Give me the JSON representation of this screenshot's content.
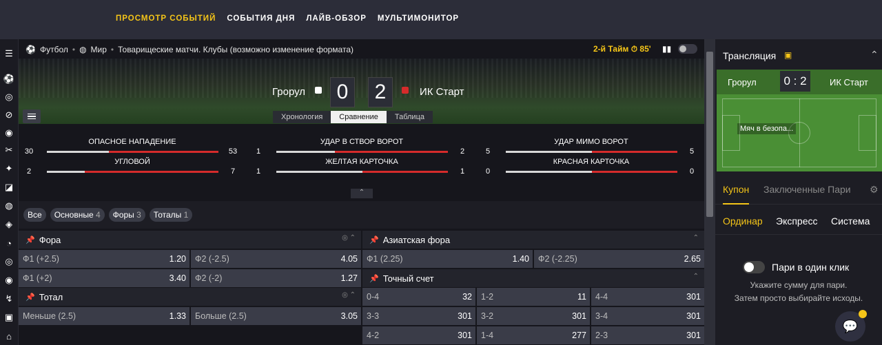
{
  "nav": {
    "items": [
      "ПРОСМОТР СОБЫТИЙ",
      "СОБЫТИЯ ДНЯ",
      "ЛАЙВ-ОБЗОР",
      "МУЛЬТИМОНИТОР"
    ],
    "active": 0
  },
  "breadcrumb": {
    "sport": "Футбол",
    "region": "Мир",
    "league": "Товарищеские матчи. Клубы (возможно изменение формата)"
  },
  "match": {
    "period": "2-й Тайм",
    "minute": "85'",
    "home": "Грорул",
    "away": "ИК Старт",
    "home_score": "0",
    "away_score": "2",
    "tabs": [
      "Хронология",
      "Сравнение",
      "Таблица"
    ],
    "active_tab": 1
  },
  "stats": [
    {
      "label": "ОПАСНОЕ НАПАДЕНИЕ",
      "home": "30",
      "away": "53",
      "away_share": 0.64
    },
    {
      "label": "УДАР В СТВОР ВОРОТ",
      "home": "1",
      "away": "2",
      "away_share": 0.66
    },
    {
      "label": "УДАР МИМО ВОРОТ",
      "home": "5",
      "away": "5",
      "away_share": 0.5
    },
    {
      "label": "УГЛОВОЙ",
      "home": "2",
      "away": "7",
      "away_share": 0.78
    },
    {
      "label": "ЖЕЛТАЯ КАРТОЧКА",
      "home": "1",
      "away": "1",
      "away_share": 0.5
    },
    {
      "label": "КРАСНАЯ КАРТОЧКА",
      "home": "0",
      "away": "0",
      "away_share": 0.5
    }
  ],
  "filters": [
    {
      "label": "Все",
      "count": ""
    },
    {
      "label": "Основные",
      "count": "4"
    },
    {
      "label": "Форы",
      "count": "3"
    },
    {
      "label": "Тоталы",
      "count": "1"
    }
  ],
  "markets": {
    "fora": {
      "title": "Фора",
      "rows": [
        [
          "Ф1 (+2.5)",
          "1.20",
          "Ф2 (-2.5)",
          "4.05"
        ],
        [
          "Ф1 (+2)",
          "3.40",
          "Ф2 (-2)",
          "1.27"
        ]
      ]
    },
    "total": {
      "title": "Тотал",
      "rows": [
        [
          "Меньше (2.5)",
          "1.33",
          "Больше (2.5)",
          "3.05"
        ]
      ]
    },
    "asian": {
      "title": "Азиатская фора",
      "rows": [
        [
          "Ф1 (2.25)",
          "1.40",
          "Ф2 (-2.25)",
          "2.65"
        ]
      ]
    },
    "exact": {
      "title": "Точный счет",
      "rows": [
        [
          "0-4",
          "32",
          "1-2",
          "11",
          "4-4",
          "301"
        ],
        [
          "3-3",
          "301",
          "3-2",
          "301",
          "3-4",
          "301"
        ],
        [
          "4-2",
          "301",
          "1-4",
          "277",
          "2-3",
          "301"
        ]
      ]
    }
  },
  "right": {
    "title": "Трансляция",
    "home": "Грорул",
    "away": "ИК Старт",
    "score": "0 : 2",
    "pitch_msg": "Мяч в безопа...",
    "coupon_tab": "Купон",
    "bets_tab": "Заключенные Пари",
    "types": [
      "Ординар",
      "Экспресс",
      "Система"
    ],
    "oneclick": "Пари в один клик",
    "hint1": "Укажите сумму для пари.",
    "hint2": "Затем просто выбирайте исходы."
  },
  "colors": {
    "accent": "#f5c518",
    "bar_away": "#d52b2b",
    "bar_home": "#d8d8d8"
  }
}
